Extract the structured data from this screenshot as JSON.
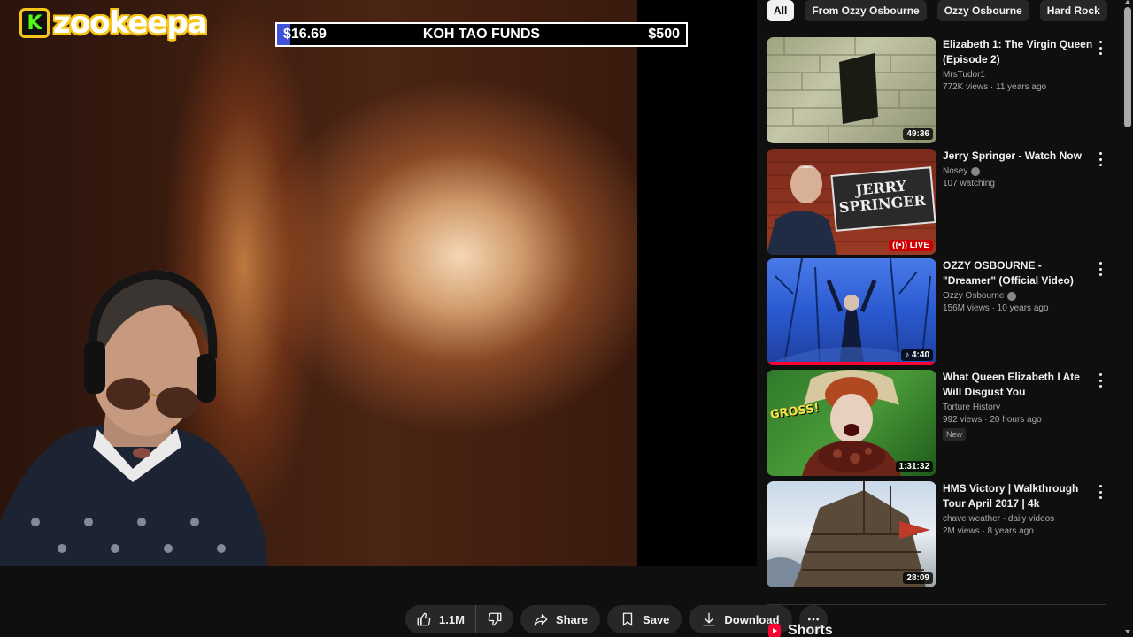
{
  "overlay": {
    "logo_letter": "K",
    "logo_text": "zookeepa",
    "funds": {
      "current": "$16.69",
      "title": "KOH TAO FUNDS",
      "goal": "$500",
      "progress_fraction": 0.0334,
      "fill_color": "#3f51d8"
    }
  },
  "actions": {
    "like_count": "1.1M",
    "share_label": "Share",
    "save_label": "Save",
    "download_label": "Download"
  },
  "chips": [
    {
      "label": "All",
      "active": true
    },
    {
      "label": "From Ozzy Osbourne",
      "active": false
    },
    {
      "label": "Ozzy Osbourne",
      "active": false
    },
    {
      "label": "Hard Rock",
      "active": false
    }
  ],
  "recommendations": [
    {
      "title": "Elizabeth 1:  The Virgin Queen (Episode 2)",
      "channel": "MrsTudor1",
      "verified": false,
      "stats": "772K views · 11 years ago",
      "duration": "49:36",
      "live": false,
      "badge": ""
    },
    {
      "title": "Jerry Springer - Watch Now",
      "channel": "Nosey",
      "verified": true,
      "stats": "107 watching",
      "duration": "",
      "live": true,
      "live_label": "LIVE",
      "badge": "",
      "thumb_text": "JERRY SPRINGER"
    },
    {
      "title": "OZZY OSBOURNE - \"Dreamer\" (Official Video)",
      "channel": "Ozzy Osbourne",
      "verified": true,
      "stats": "156M views · 10 years ago",
      "duration": "4:40",
      "live": false,
      "badge": "",
      "watched_fraction": 1.0
    },
    {
      "title": "What Queen Elizabeth I Ate Will Disgust You",
      "channel": "Torture History",
      "verified": false,
      "stats": "992 views · 20 hours ago",
      "duration": "1:31:32",
      "live": false,
      "badge": "New",
      "thumb_text": "GROSS!"
    },
    {
      "title": "HMS Victory | Walkthrough Tour April 2017 | 4k",
      "channel": "chave weather - daily videos",
      "verified": false,
      "stats": "2M views · 8 years ago",
      "duration": "28:09",
      "live": false,
      "badge": ""
    }
  ],
  "shorts_label": "Shorts",
  "colors": {
    "background": "#0f0f0f",
    "chip": "#272727",
    "live_red": "#cc0000",
    "accent_red": "#ff0033",
    "logo_yellow": "#f5c518",
    "logo_green": "#53fc18"
  }
}
